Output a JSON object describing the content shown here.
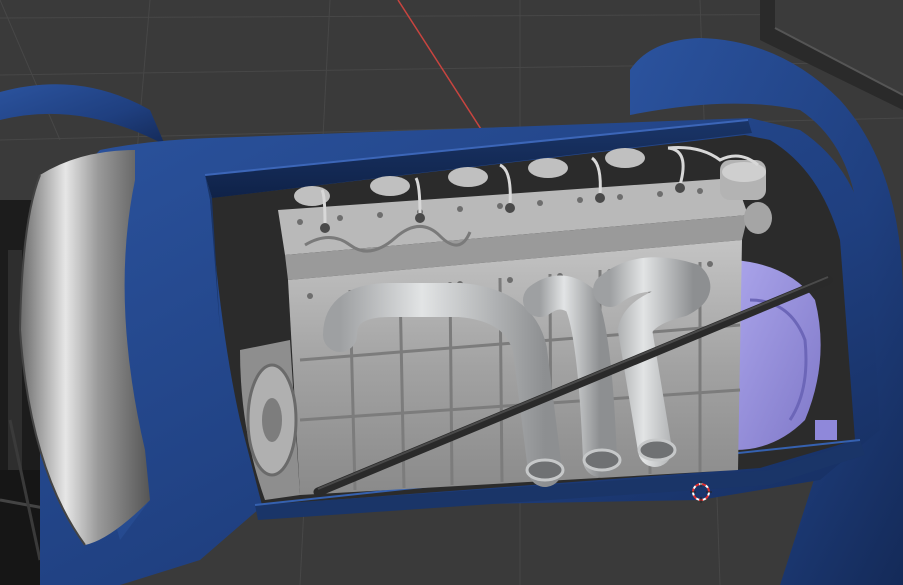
{
  "viewport": {
    "background": "#3a3a3a",
    "grid_color": "#4a4a4a",
    "x_axis_color": "#c8443f"
  },
  "colors": {
    "body_blue": "#1f3f7f",
    "body_blue_light": "#2e5aa8",
    "body_blue_dark": "#152c5c",
    "engine_metal": "#a9a9a9",
    "engine_metal_dark": "#6e6e6e",
    "exhaust_metal": "#c9cbcc",
    "transmission_lavender": "#9d97df",
    "rod_dark": "#2a2a2a",
    "chrome_ring": "#b8b8b8"
  },
  "objects": {
    "engine_block": "engine-block",
    "exhaust_pipes": [
      "exhaust-pipe-1",
      "exhaust-pipe-2",
      "exhaust-pipe-3"
    ],
    "spark_plugs": 6,
    "steering_rod": "steering-rod",
    "transmission": "transmission-housing",
    "body_shell": "car-body-shell",
    "cursor": "3d-cursor-icon"
  }
}
